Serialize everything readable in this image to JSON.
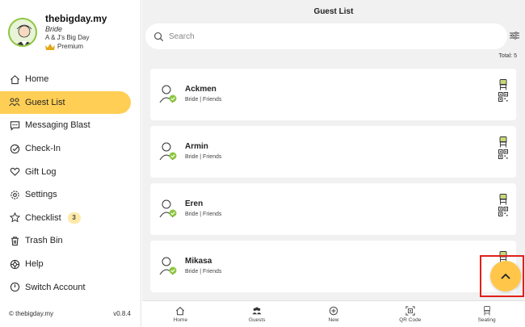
{
  "profile": {
    "name": "thebigday.my",
    "role": "Bride",
    "event": "A & J's Big Day",
    "plan": "Premium"
  },
  "sidebar": {
    "items": [
      {
        "label": "Home",
        "icon": "home-icon"
      },
      {
        "label": "Guest List",
        "icon": "guests-icon",
        "active": true
      },
      {
        "label": "Messaging Blast",
        "icon": "message-icon"
      },
      {
        "label": "Check-In",
        "icon": "check-icon"
      },
      {
        "label": "Gift Log",
        "icon": "heart-icon"
      },
      {
        "label": "Settings",
        "icon": "gear-icon"
      },
      {
        "label": "Checklist",
        "icon": "checklist-icon",
        "badge": "3"
      },
      {
        "label": "Trash Bin",
        "icon": "trash-icon"
      },
      {
        "label": "Help",
        "icon": "help-icon"
      },
      {
        "label": "Switch Account",
        "icon": "power-icon"
      }
    ],
    "footer": {
      "copyright": "© thebigday.my",
      "version": "v0.8.4"
    }
  },
  "main": {
    "title": "Guest List",
    "search_placeholder": "Search",
    "total": "Total: 5",
    "guests": [
      {
        "name": "Ackmen",
        "meta": "Bride  |  Friends"
      },
      {
        "name": "Armin",
        "meta": "Bride  |  Friends"
      },
      {
        "name": "Eren",
        "meta": "Bride  |  Friends"
      },
      {
        "name": "Mikasa",
        "meta": "Bride  |  Friends"
      }
    ]
  },
  "tabbar": {
    "tabs": [
      {
        "label": "Home",
        "icon": "home-icon"
      },
      {
        "label": "Guests",
        "icon": "guests-icon"
      },
      {
        "label": "New",
        "icon": "plus-circle-icon"
      },
      {
        "label": "QR Code",
        "icon": "qr-scan-icon"
      },
      {
        "label": "Seating",
        "icon": "chair-icon"
      }
    ]
  },
  "colors": {
    "accent": "#ffcf55",
    "fab": "#ffc64a",
    "highlight": "#e0201b",
    "check_green": "#8cc63f"
  }
}
